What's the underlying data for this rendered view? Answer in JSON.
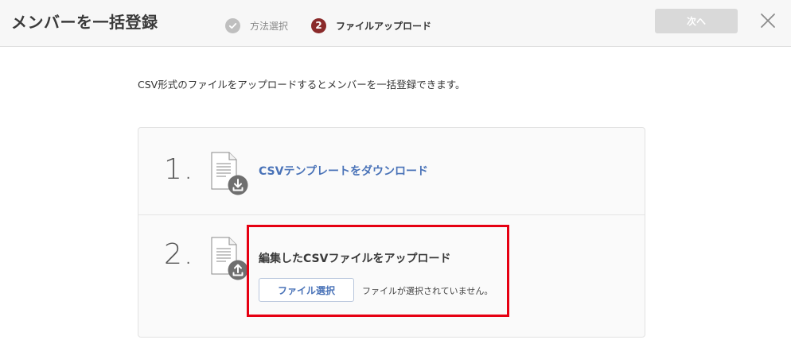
{
  "header": {
    "title": "メンバーを一括登録",
    "steps": [
      {
        "number": "",
        "label": "方法選択",
        "state": "done"
      },
      {
        "number": "2",
        "label": "ファイルアップロード",
        "state": "active"
      }
    ],
    "next_label": "次へ"
  },
  "main": {
    "description": "CSV形式のファイルをアップロードするとメンバーを一括登録できます。",
    "step1": {
      "number": "1.",
      "link_label": "CSVテンプレートをダウンロード"
    },
    "step2": {
      "number": "2.",
      "title": "編集したCSVファイルをアップロード",
      "button_label": "ファイル選択",
      "status_text": "ファイルが選択されていません。"
    }
  },
  "colors": {
    "accent_link": "#4a73b8",
    "active_step": "#8a2a2a",
    "highlight": "#e60012"
  },
  "icons": {
    "done_step": "check-icon",
    "close": "close-icon",
    "download": "download-file-icon",
    "upload": "upload-file-icon"
  }
}
